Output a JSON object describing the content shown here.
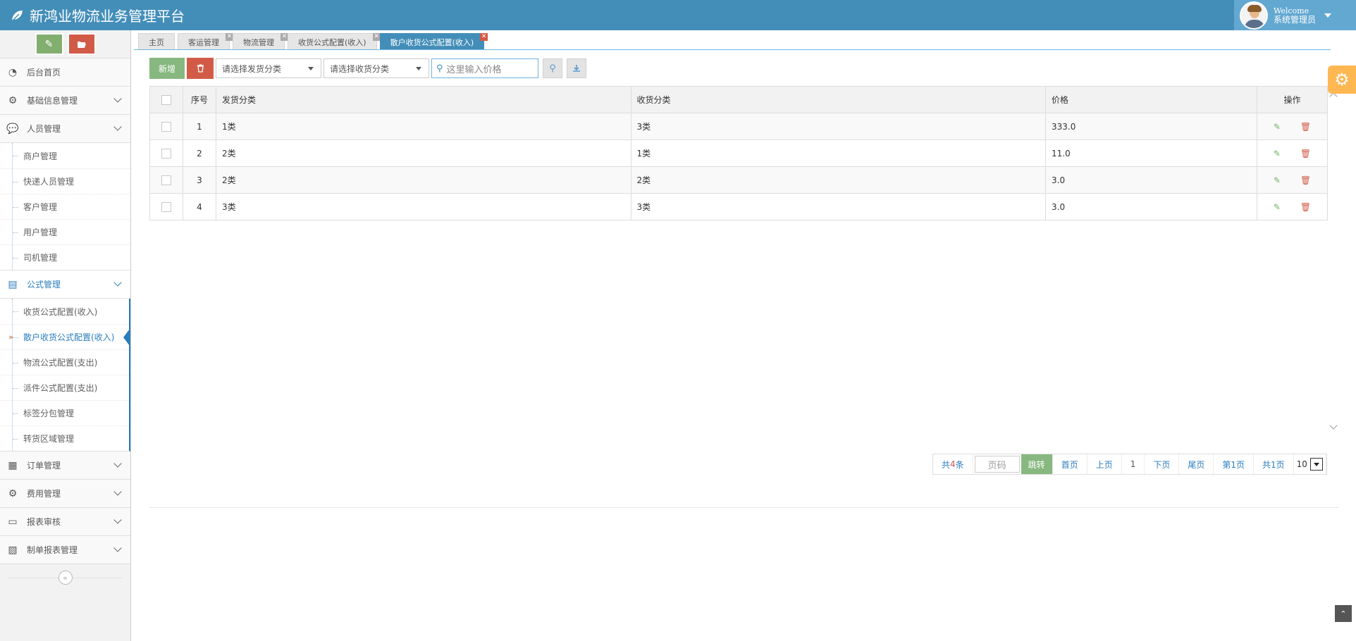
{
  "app": {
    "title": "新鸿业物流业务管理平台",
    "welcome": "Welcome",
    "user_name": "系统管理员"
  },
  "colors": {
    "topbar": "#438eb9",
    "accent": "#2b7dbc",
    "green": "#87b87f",
    "red": "#d15b47",
    "orange": "#ffb752"
  },
  "sidebar": {
    "shortcuts": [
      {
        "icon": "pencil-icon"
      },
      {
        "icon": "folder-open-icon"
      }
    ],
    "items": [
      {
        "label": "后台首页",
        "icon": "dashboard-icon"
      },
      {
        "label": "基础信息管理",
        "icon": "cogs-icon"
      },
      {
        "label": "人员管理",
        "icon": "comments-icon",
        "children": [
          "商户管理",
          "快递人员管理",
          "客户管理",
          "用户管理",
          "司机管理"
        ]
      },
      {
        "label": "公式管理",
        "icon": "book-icon",
        "children": [
          "收货公式配置(收入)",
          "散户收货公式配置(收入)",
          "物流公式配置(支出)",
          "派件公式配置(支出)",
          "标签分包管理",
          "转货区域管理"
        ]
      },
      {
        "label": "订单管理",
        "icon": "calendar-icon"
      },
      {
        "label": "费用管理",
        "icon": "cogs-icon"
      },
      {
        "label": "报表审核",
        "icon": "desktop-icon"
      },
      {
        "label": "制单报表管理",
        "icon": "picture-icon"
      }
    ]
  },
  "tabs": [
    {
      "label": "主页",
      "closable": false
    },
    {
      "label": "客运管理",
      "closable": true
    },
    {
      "label": "物流管理",
      "closable": true
    },
    {
      "label": "收货公式配置(收入)",
      "closable": true
    },
    {
      "label": "散户收货公式配置(收入)",
      "closable": true,
      "active": true
    }
  ],
  "toolbar": {
    "new_label": "新增",
    "send_select": "请选择发货分类",
    "recv_select": "请选择收货分类",
    "search_placeholder": "这里输入价格"
  },
  "table": {
    "headers": {
      "index": "序号",
      "send": "发货分类",
      "recv": "收货分类",
      "price": "价格",
      "ops": "操作"
    },
    "rows": [
      {
        "index": "1",
        "send": "1类",
        "recv": "3类",
        "price": "333.0"
      },
      {
        "index": "2",
        "send": "2类",
        "recv": "1类",
        "price": "11.0"
      },
      {
        "index": "3",
        "send": "2类",
        "recv": "2类",
        "price": "3.0"
      },
      {
        "index": "4",
        "send": "3类",
        "recv": "3类",
        "price": "3.0"
      }
    ]
  },
  "pager": {
    "total_prefix": "共",
    "total_count": "4",
    "total_suffix": "条",
    "page_placeholder": "页码",
    "jump": "跳转",
    "first": "首页",
    "prev": "上页",
    "current": "1",
    "next": "下页",
    "last": "尾页",
    "page_info": "第1页",
    "page_total": "共1页",
    "page_size": "10"
  }
}
